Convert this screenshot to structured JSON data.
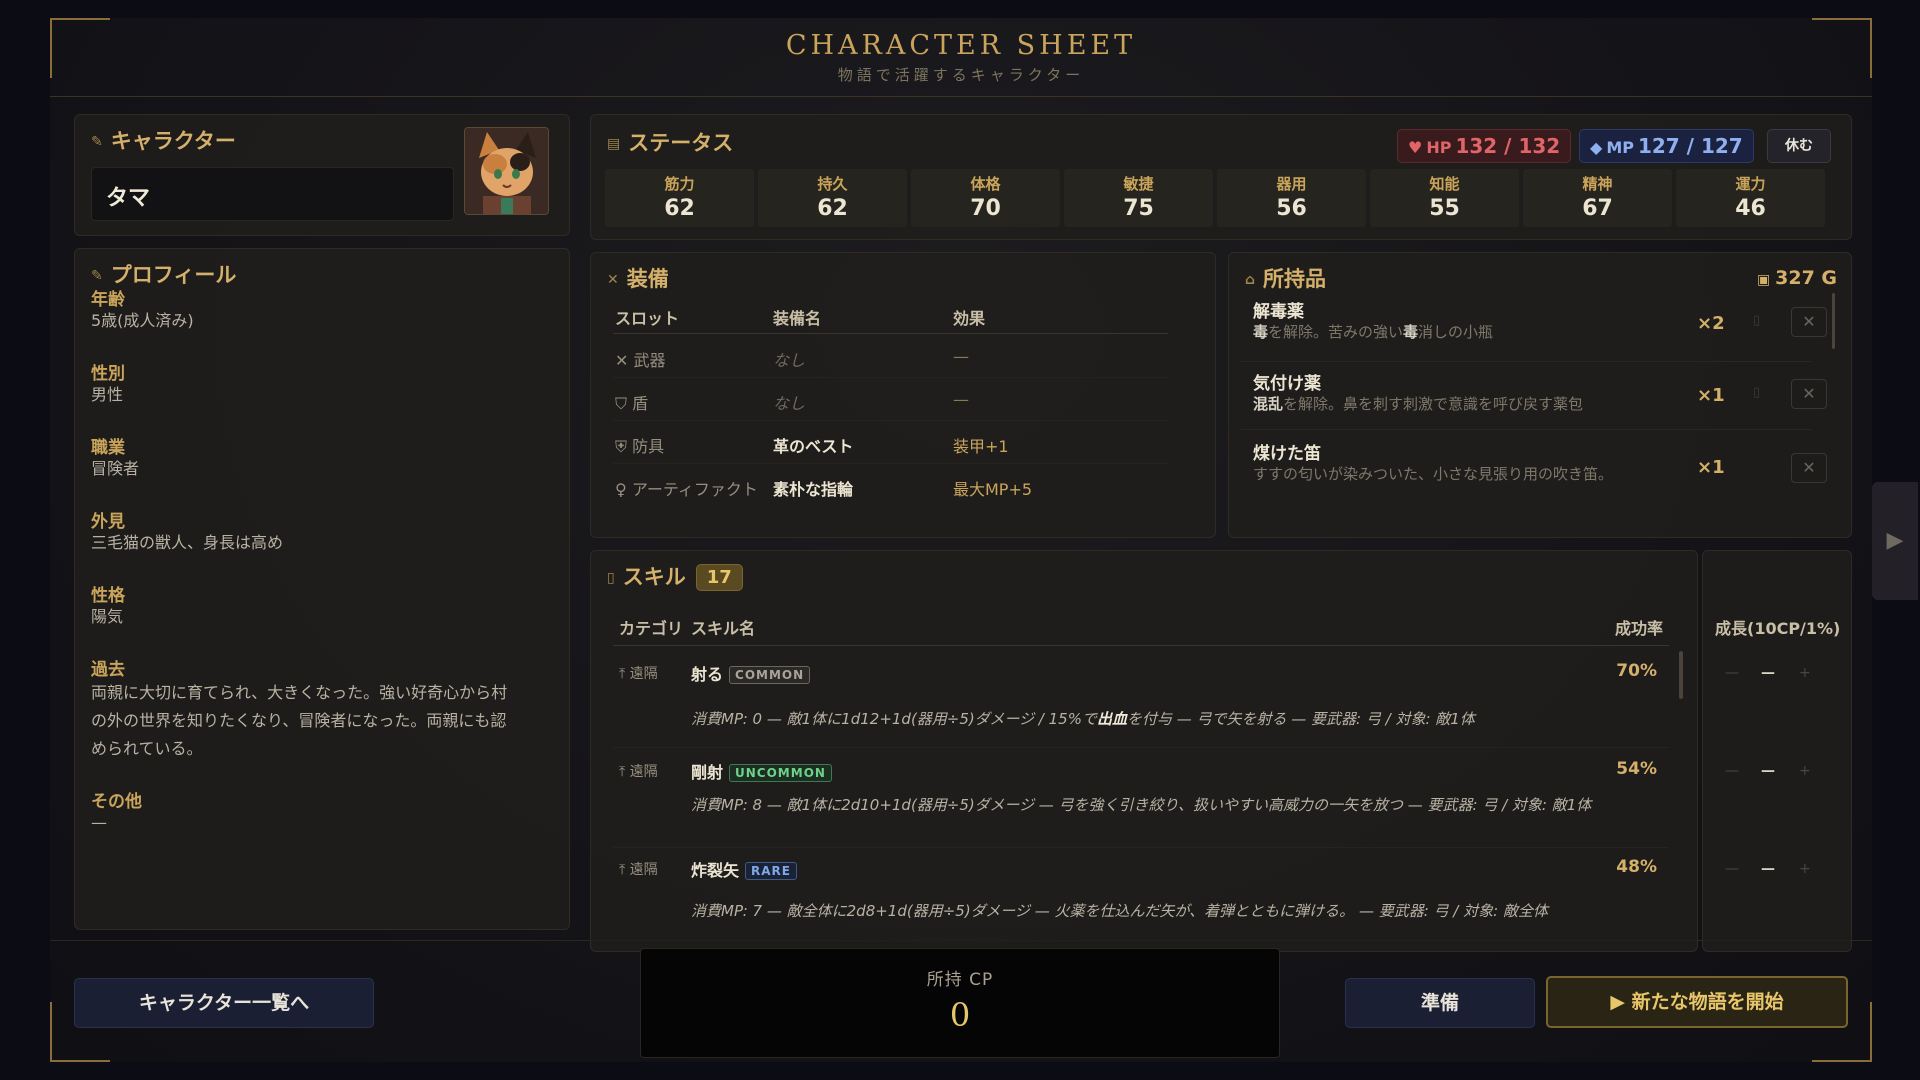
{
  "header": {
    "title": "CHARACTER SHEET",
    "subtitle": "物語で活躍するキャラクター"
  },
  "character": {
    "title": "キャラクター",
    "name": "タマ"
  },
  "profile": {
    "title": "プロフィール",
    "fields": [
      {
        "label": "年齢",
        "value": "5歳(成人済み)"
      },
      {
        "label": "性別",
        "value": "男性"
      },
      {
        "label": "職業",
        "value": "冒険者"
      },
      {
        "label": "外見",
        "value": "三毛猫の獣人、身長は高め"
      },
      {
        "label": "性格",
        "value": "陽気"
      },
      {
        "label": "過去",
        "value": "両親に大切に育てられ、大きくなった。強い好奇心から村の外の世界を知りたくなり、冒険者になった。両親にも認められている。"
      },
      {
        "label": "その他",
        "value": "—"
      }
    ]
  },
  "status": {
    "title": "ステータス",
    "hp": {
      "label": "HP",
      "value": "132 / 132"
    },
    "mp": {
      "label": "MP",
      "value": "127 / 127"
    },
    "rest_label": "休む",
    "stats": [
      {
        "name": "筋力",
        "value": "62"
      },
      {
        "name": "持久",
        "value": "62"
      },
      {
        "name": "体格",
        "value": "70"
      },
      {
        "name": "敏捷",
        "value": "75"
      },
      {
        "name": "器用",
        "value": "56"
      },
      {
        "name": "知能",
        "value": "55"
      },
      {
        "name": "精神",
        "value": "67"
      },
      {
        "name": "運力",
        "value": "46"
      }
    ]
  },
  "equipment": {
    "title": "装備",
    "headers": {
      "slot": "スロット",
      "name": "装備名",
      "effect": "効果"
    },
    "rows": [
      {
        "icon": "✕",
        "slot": "武器",
        "name": "なし",
        "effect": "—"
      },
      {
        "icon": "⛉",
        "slot": "盾",
        "name": "なし",
        "effect": "—"
      },
      {
        "icon": "⛨",
        "slot": "防具",
        "name": "革のベスト",
        "effect": "装甲+1"
      },
      {
        "icon": "♀",
        "slot": "アーティファクト",
        "name": "素朴な指輪",
        "effect": "最大MP+5"
      }
    ]
  },
  "inventory": {
    "title": "所持品",
    "gold": "327 G",
    "items": [
      {
        "name": "解毒薬",
        "desc_bold_1": "毒",
        "desc_1": "を解除。苦みの強い",
        "desc_bold_2": "毒",
        "desc_2": "消しの小瓶",
        "qty": "×2"
      },
      {
        "name": "気付け薬",
        "desc_bold_1": "混乱",
        "desc_1": "を解除。鼻を刺す刺激で意識を呼び戻す薬包",
        "desc_bold_2": "",
        "desc_2": "",
        "qty": "×1"
      },
      {
        "name": "煤けた笛",
        "desc_bold_1": "",
        "desc_1": "すすの匂いが染みついた、小さな見張り用の吹き笛。",
        "desc_bold_2": "",
        "desc_2": "",
        "qty": "×1"
      }
    ]
  },
  "skills": {
    "title": "スキル",
    "count": "17",
    "headers": {
      "category": "カテゴリ",
      "name": "スキル名",
      "rate": "成功率",
      "growth": "成長(10CP/1%)"
    },
    "rows": [
      {
        "category": "遠隔",
        "name": "射る",
        "rarity": "COMMON",
        "rate": "70%",
        "desc_a": "消費MP: 0 — 敵1体に1d12+1d(器用÷5)ダメージ / 15%で",
        "desc_b": "出血",
        "desc_c": "を付与 — 弓で矢を射る — 要武器: 弓 / 対象: 敵1体",
        "growth": "—"
      },
      {
        "category": "遠隔",
        "name": "剛射",
        "rarity": "UNCOMMON",
        "rate": "54%",
        "desc_a": "消費MP: 8 — 敵1体に2d10+1d(器用÷5)ダメージ — 弓を強く引き絞り、扱いやすい高威力の一矢を放つ — 要武器: 弓 / 対象: 敵1体",
        "desc_b": "",
        "desc_c": "",
        "growth": "—"
      },
      {
        "category": "遠隔",
        "name": "炸裂矢",
        "rarity": "RARE",
        "rate": "48%",
        "desc_a": "消費MP: 7 — 敵全体に2d8+1d(器用÷5)ダメージ — 火薬を仕込んだ矢が、着弾とともに弾ける。 — 要武器: 弓 / 対象: 敵全体",
        "desc_b": "",
        "desc_c": "",
        "growth": "—"
      }
    ]
  },
  "footer": {
    "list_button": "キャラクター一覧へ",
    "cp_label": "所持 CP",
    "cp_value": "0",
    "prep_button": "準備",
    "start_button": "▶ 新たな物語を開始"
  },
  "icons": {
    "pen": "pen-icon",
    "heart": "heart-icon",
    "gem": "gem-icon",
    "coin": "coin-icon",
    "bag": "bag-icon"
  },
  "colors": {
    "accent": "#c9a45a",
    "hp": "#e06468",
    "mp": "#8fb0f0",
    "uncommon": "#6fd28a",
    "rare": "#7fa8e8"
  }
}
